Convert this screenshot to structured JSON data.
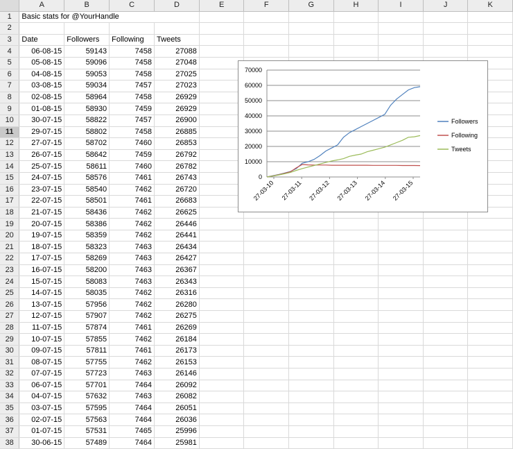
{
  "columns": [
    "A",
    "B",
    "C",
    "D",
    "E",
    "F",
    "G",
    "H",
    "I",
    "J",
    "K"
  ],
  "sheet_title": "Basic stats for @YourHandle",
  "headers": [
    "Date",
    "Followers",
    "Following",
    "Tweets"
  ],
  "selected_row": 11,
  "rows": [
    [
      "06-08-15",
      "59143",
      "7458",
      "27088"
    ],
    [
      "05-08-15",
      "59096",
      "7458",
      "27048"
    ],
    [
      "04-08-15",
      "59053",
      "7458",
      "27025"
    ],
    [
      "03-08-15",
      "59034",
      "7457",
      "27023"
    ],
    [
      "02-08-15",
      "58964",
      "7458",
      "26929"
    ],
    [
      "01-08-15",
      "58930",
      "7459",
      "26929"
    ],
    [
      "30-07-15",
      "58822",
      "7457",
      "26900"
    ],
    [
      "29-07-15",
      "58802",
      "7458",
      "26885"
    ],
    [
      "27-07-15",
      "58702",
      "7460",
      "26853"
    ],
    [
      "26-07-15",
      "58642",
      "7459",
      "26792"
    ],
    [
      "25-07-15",
      "58611",
      "7460",
      "26782"
    ],
    [
      "24-07-15",
      "58576",
      "7461",
      "26743"
    ],
    [
      "23-07-15",
      "58540",
      "7462",
      "26720"
    ],
    [
      "22-07-15",
      "58501",
      "7461",
      "26683"
    ],
    [
      "21-07-15",
      "58436",
      "7462",
      "26625"
    ],
    [
      "20-07-15",
      "58386",
      "7462",
      "26446"
    ],
    [
      "19-07-15",
      "58359",
      "7462",
      "26441"
    ],
    [
      "18-07-15",
      "58323",
      "7463",
      "26434"
    ],
    [
      "17-07-15",
      "58269",
      "7463",
      "26427"
    ],
    [
      "16-07-15",
      "58200",
      "7463",
      "26367"
    ],
    [
      "15-07-15",
      "58083",
      "7463",
      "26343"
    ],
    [
      "14-07-15",
      "58035",
      "7462",
      "26316"
    ],
    [
      "13-07-15",
      "57956",
      "7462",
      "26280"
    ],
    [
      "12-07-15",
      "57907",
      "7462",
      "26275"
    ],
    [
      "11-07-15",
      "57874",
      "7461",
      "26269"
    ],
    [
      "10-07-15",
      "57855",
      "7462",
      "26184"
    ],
    [
      "09-07-15",
      "57811",
      "7461",
      "26173"
    ],
    [
      "08-07-15",
      "57755",
      "7462",
      "26153"
    ],
    [
      "07-07-15",
      "57723",
      "7463",
      "26146"
    ],
    [
      "06-07-15",
      "57701",
      "7464",
      "26092"
    ],
    [
      "04-07-15",
      "57632",
      "7463",
      "26082"
    ],
    [
      "03-07-15",
      "57595",
      "7464",
      "26051"
    ],
    [
      "02-07-15",
      "57563",
      "7464",
      "26036"
    ],
    [
      "01-07-15",
      "57531",
      "7465",
      "25996"
    ],
    [
      "30-06-15",
      "57489",
      "7464",
      "25981"
    ]
  ],
  "chart_data": {
    "type": "line",
    "x_tick_labels": [
      "27-03-10",
      "27-03-11",
      "27-03-12",
      "27-03-13",
      "27-03-14",
      "27-03-15"
    ],
    "x": [
      "27-03-10",
      "27-06-10",
      "27-09-10",
      "27-12-10",
      "27-01-11",
      "27-02-11",
      "27-03-11",
      "27-04-11",
      "27-06-11",
      "27-09-11",
      "27-12-11",
      "27-03-12",
      "27-06-12",
      "27-09-12",
      "27-12-12",
      "27-01-13",
      "27-03-13",
      "27-06-13",
      "27-09-13",
      "27-12-13",
      "27-03-14",
      "27-06-14",
      "27-09-14",
      "27-12-14",
      "27-03-15",
      "27-06-15",
      "06-08-15"
    ],
    "ylim": [
      0,
      70000
    ],
    "yticks": [
      0,
      10000,
      20000,
      30000,
      40000,
      50000,
      60000,
      70000
    ],
    "grid": true,
    "legend_position": "right",
    "series": [
      {
        "name": "Followers",
        "color": "#4f81bd",
        "values": [
          0,
          800,
          1600,
          2600,
          3600,
          5500,
          9000,
          10000,
          11500,
          14000,
          17000,
          19000,
          21000,
          26000,
          29000,
          31000,
          33000,
          35000,
          37000,
          39000,
          41000,
          47000,
          51000,
          54000,
          57000,
          58500,
          59143
        ]
      },
      {
        "name": "Following",
        "color": "#c0504d",
        "values": [
          0,
          700,
          1500,
          2400,
          3400,
          6000,
          8200,
          7900,
          7800,
          7800,
          7800,
          7700,
          7700,
          7700,
          7700,
          7700,
          7700,
          7700,
          7600,
          7600,
          7600,
          7600,
          7600,
          7500,
          7500,
          7500,
          7458
        ]
      },
      {
        "name": "Tweets",
        "color": "#9bbb59",
        "values": [
          0,
          600,
          1300,
          2100,
          3000,
          4300,
          5500,
          6500,
          7500,
          8500,
          9500,
          10500,
          11200,
          12000,
          13500,
          14300,
          15000,
          16500,
          17500,
          18500,
          19500,
          21000,
          22500,
          24000,
          26000,
          26300,
          27088
        ]
      }
    ]
  }
}
